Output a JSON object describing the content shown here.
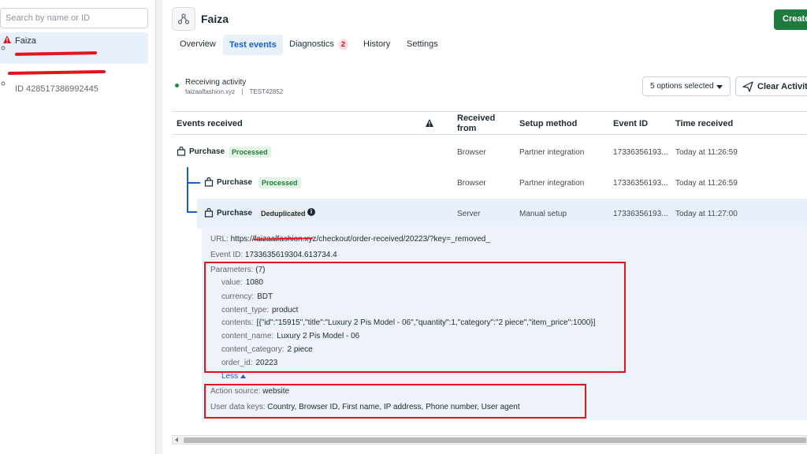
{
  "sidebar": {
    "search_placeholder": "Search by name or ID",
    "selected": {
      "name": "Faiza"
    },
    "other": {
      "id": "ID 428517386992445"
    }
  },
  "header": {
    "title": "Faiza",
    "create_label": "Create"
  },
  "tabs": [
    {
      "label": "Overview"
    },
    {
      "label": "Test events"
    },
    {
      "label": "Diagnostics",
      "badge": "2"
    },
    {
      "label": "History"
    },
    {
      "label": "Settings"
    }
  ],
  "status": {
    "label": "Receiving activity",
    "domain": "faizaalfashion.xyz",
    "separator": "|",
    "code": "TEST42852"
  },
  "controls": {
    "options_selected": "5 options selected",
    "clear_label": "Clear Activity"
  },
  "table": {
    "headers": {
      "events": "Events received",
      "received_from": "Received from",
      "setup": "Setup method",
      "event_id": "Event ID",
      "time": "Time received"
    },
    "rows": [
      {
        "name": "Purchase",
        "status": "Processed",
        "from": "Browser",
        "setup": "Partner integration",
        "event_id": "17336356193...",
        "time": "Today at 11:26:59"
      },
      {
        "name": "Purchase",
        "status": "Processed",
        "from": "Browser",
        "setup": "Partner integration",
        "event_id": "17336356193...",
        "time": "Today at 11:26:59"
      },
      {
        "name": "Purchase",
        "status": "Deduplicated",
        "from": "Server",
        "setup": "Manual setup",
        "event_id": "17336356193...",
        "time": "Today at 11:27:00"
      }
    ]
  },
  "detail": {
    "url_label": "URL:",
    "url_value": "https://faizaalfashion.xyz/checkout/order-received/20223/?key=_removed_",
    "event_id_label": "Event ID:",
    "event_id_value": "1733635619304.613734.4",
    "params_label": "Parameters:",
    "params_count": "(7)",
    "params": [
      {
        "key": "value:",
        "val": "1080"
      },
      {
        "key": "currency:",
        "val": "BDT"
      },
      {
        "key": "content_type:",
        "val": "product"
      },
      {
        "key": "contents:",
        "val": "[{\"id\":\"15915\",\"title\":\"Luxury 2 Pis Model - 06\",\"quantity\":1,\"category\":\"2 piece\",\"item_price\":1000}]"
      },
      {
        "key": "content_name:",
        "val": "Luxury 2 Pis Model - 06"
      },
      {
        "key": "content_category:",
        "val": "2 piece"
      },
      {
        "key": "order_id:",
        "val": "20223"
      }
    ],
    "less_label": "Less",
    "action_source_label": "Action source:",
    "action_source_value": "website",
    "user_keys_label": "User data keys:",
    "user_keys_value": "Country, Browser ID, First name, IP address, Phone number, User agent"
  },
  "colors": {
    "accent": "#1461c7",
    "create": "#1f7a3e",
    "processed": "#1e7b34",
    "highlight_box": "#e0161c"
  }
}
